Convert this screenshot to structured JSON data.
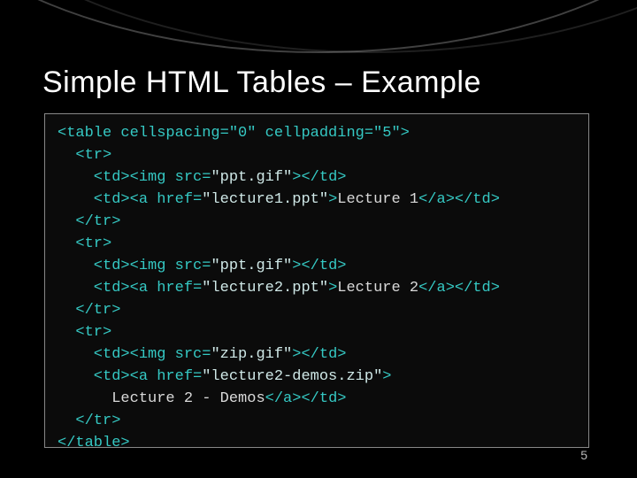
{
  "title": "Simple HTML Tables – Example",
  "page_number": "5",
  "code": {
    "l01": "<table cellspacing=\"0\" cellpadding=\"5\">",
    "l02": "  <tr>",
    "l03a": "    <td><img src=",
    "l03b": "\"ppt.gif\"",
    "l03c": "></td>",
    "l04a": "    <td><a href=",
    "l04b": "\"lecture1.ppt\"",
    "l04c": ">",
    "l04d": "Lecture 1",
    "l04e": "</a></td>",
    "l05": "  </tr>",
    "l06": "  <tr>",
    "l07a": "    <td><img src=",
    "l07b": "\"ppt.gif\"",
    "l07c": "></td>",
    "l08a": "    <td><a href=",
    "l08b": "\"lecture2.ppt\"",
    "l08c": ">",
    "l08d": "Lecture 2",
    "l08e": "</a></td>",
    "l09": "  </tr>",
    "l10": "  <tr>",
    "l11a": "    <td><img src=",
    "l11b": "\"zip.gif\"",
    "l11c": "></td>",
    "l12a": "    <td><a href=",
    "l12b": "\"lecture2-demos.zip\"",
    "l12c": ">",
    "l13a": "      ",
    "l13b": "Lecture 2 - Demos",
    "l13c": "</a></td>",
    "l14": "  </tr>",
    "l15": "</table>"
  }
}
